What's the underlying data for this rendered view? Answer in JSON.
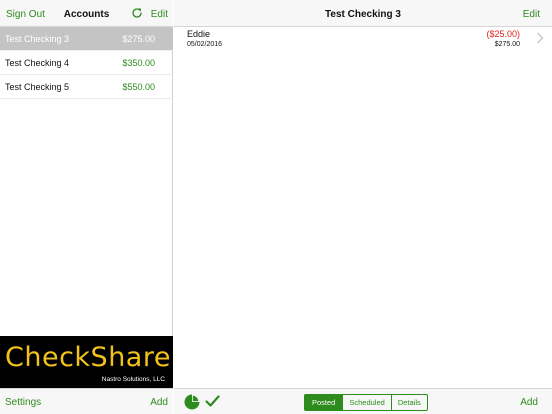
{
  "sidebar": {
    "nav": {
      "sign_out": "Sign Out",
      "title": "Accounts",
      "edit": "Edit"
    },
    "accounts": [
      {
        "name": "Test Checking 3",
        "balance": "$275.00",
        "selected": true
      },
      {
        "name": "Test Checking 4",
        "balance": "$350.00",
        "selected": false
      },
      {
        "name": "Test Checking 5",
        "balance": "$550.00",
        "selected": false
      }
    ],
    "logo": {
      "brand": "CheckShare",
      "company": "Nastro Solutions, LLC"
    },
    "bottom": {
      "settings": "Settings",
      "add": "Add"
    }
  },
  "main": {
    "nav": {
      "title": "Test Checking 3",
      "edit": "Edit"
    },
    "transactions": [
      {
        "payee": "Eddie",
        "date": "05/02/2016",
        "amount": "($25.00)",
        "running_balance": "$275.00"
      }
    ],
    "bottom": {
      "segments": [
        "Posted",
        "Scheduled",
        "Details"
      ],
      "selected_segment": "Posted",
      "add": "Add"
    }
  },
  "colors": {
    "accent": "#2e8b1e",
    "negative": "#e0231c",
    "selected_row": "#c4c4c4"
  },
  "icons": [
    "refresh-icon",
    "chevron-right-icon",
    "pie-chart-icon",
    "checkmark-icon"
  ]
}
